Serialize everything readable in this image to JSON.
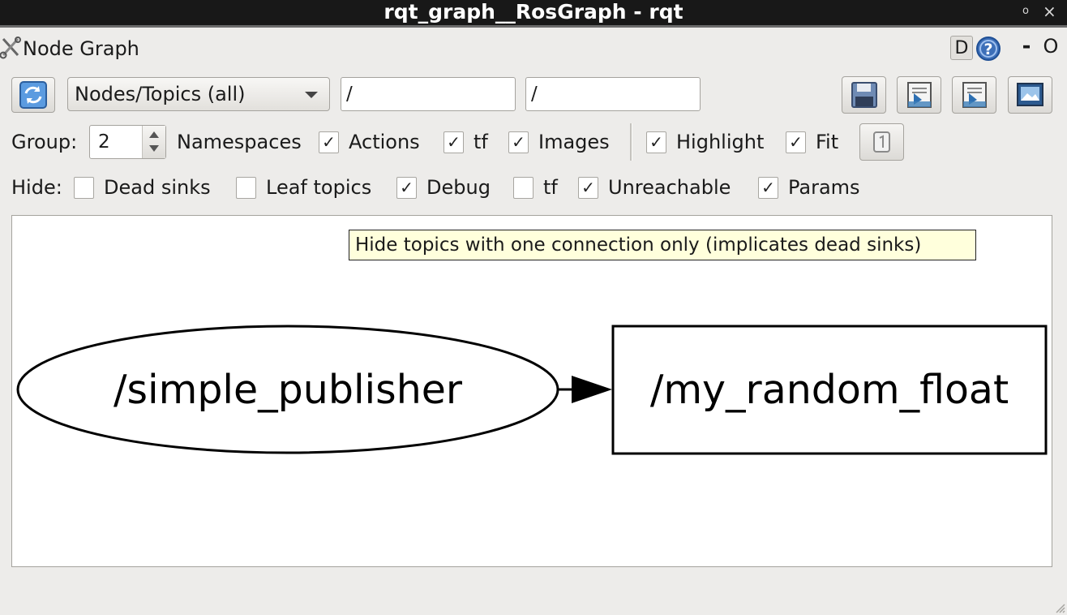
{
  "window": {
    "title": "rqt_graph__RosGraph - rqt",
    "pin_glyph": "o",
    "close_glyph": "×"
  },
  "panel": {
    "title": "Node Graph",
    "d_label": "D",
    "help_glyph": "?",
    "min_glyph": "-",
    "close_glyph": "O"
  },
  "toolbar": {
    "view_mode": "Nodes/Topics (all)",
    "node_filter": "/",
    "topic_filter": "/"
  },
  "group_row": {
    "group_label": "Group:",
    "group_value": "2",
    "namespaces_label": "Namespaces",
    "options": [
      {
        "label": "Actions",
        "checked": true
      },
      {
        "label": "tf",
        "checked": true
      },
      {
        "label": "Images",
        "checked": true
      },
      {
        "label": "Highlight",
        "checked": true
      },
      {
        "label": "Fit",
        "checked": true
      }
    ],
    "namespaces_checked": true
  },
  "hide_row": {
    "hide_label": "Hide:",
    "options": [
      {
        "label": "Dead sinks",
        "checked": false
      },
      {
        "label": "Leaf topics",
        "checked": false
      },
      {
        "label": "Debug",
        "checked": true
      },
      {
        "label": "tf",
        "checked": false
      },
      {
        "label": "Unreachable",
        "checked": true
      },
      {
        "label": "Params",
        "checked": true
      }
    ]
  },
  "checkmark": "✓",
  "tooltip": "Hide topics with one connection only (implicates dead sinks)",
  "graph": {
    "node": "/simple_publisher",
    "topic": "/my_random_float"
  },
  "colors": {
    "titlebar": "#181818",
    "tooltip_bg": "#ffffdc",
    "help_blue": "#3d6fb8"
  }
}
